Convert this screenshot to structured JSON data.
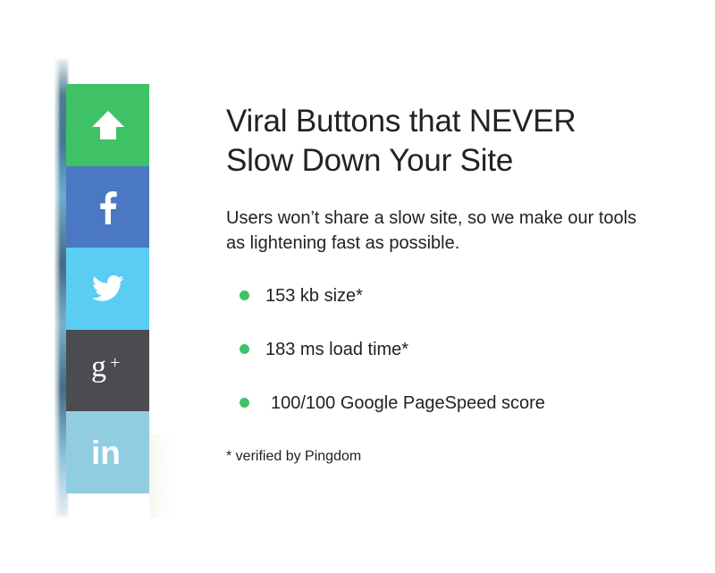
{
  "share_bar": {
    "buttons": [
      {
        "id": "up",
        "icon": "arrow-up-icon",
        "color": "#3fc266"
      },
      {
        "id": "facebook",
        "icon": "facebook-icon",
        "color": "#4b78c2"
      },
      {
        "id": "twitter",
        "icon": "twitter-bird-icon",
        "color": "#5bcdf3"
      },
      {
        "id": "googleplus",
        "icon": "google-plus-icon",
        "color": "#4a4c50",
        "glyph_main": "g",
        "glyph_sup": "+"
      },
      {
        "id": "linkedin",
        "icon": "linkedin-icon",
        "color": "#91cde0",
        "glyph": "in"
      }
    ]
  },
  "content": {
    "headline_line1": "Viral Buttons that NEVER",
    "headline_line2": "Slow Down Your Site",
    "intro_line1": "Users won’t share a slow site, so we make our tools",
    "intro_line2": "as lightening fast as possible.",
    "features": [
      "153 kb size*",
      "183 ms load time*",
      "100/100 Google PageSpeed score"
    ],
    "bullet_color": "#3fc266",
    "footnote": "* verified by Pingdom"
  }
}
